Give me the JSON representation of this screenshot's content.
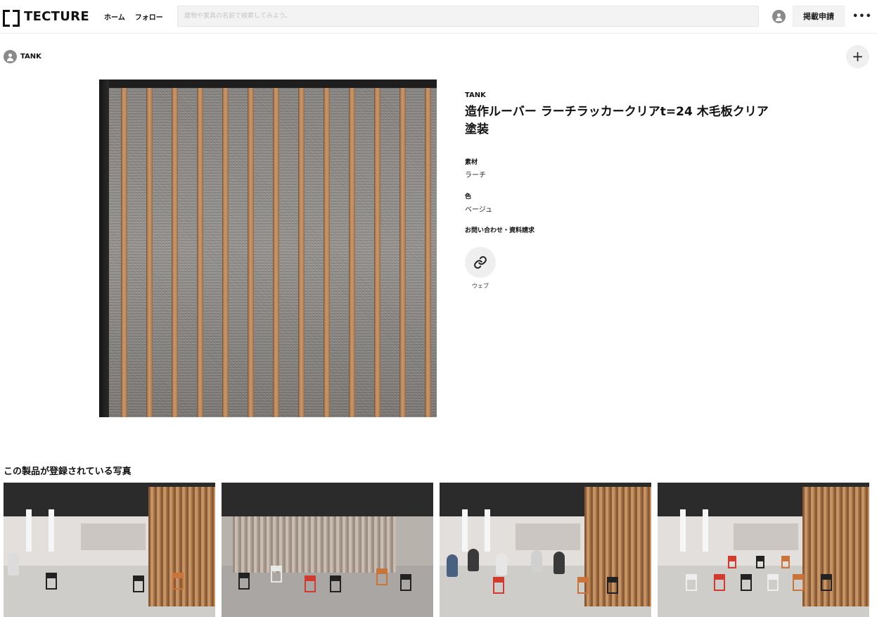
{
  "header": {
    "logo_text": "TECTURE",
    "nav": [
      "ホーム",
      "フォロー"
    ],
    "search_placeholder": "建物や家具の名前で検索してみよう。",
    "apply_label": "掲載申請",
    "more_label": "•••"
  },
  "owner": {
    "name": "TANK"
  },
  "add_label": "+",
  "product": {
    "brand": "TANK",
    "title": "造作ルーバー ラーチラッカークリアt=24 木毛板クリア塗装",
    "material_label": "素材",
    "material_value": "ラーチ",
    "color_label": "色",
    "color_value": "ベージュ",
    "contact_label": "お問い合わせ・資料請求",
    "web_label": "ウェブ"
  },
  "related": {
    "title": "この製品が登録されている写真"
  },
  "icons": {
    "header_avatar": "user-icon",
    "owner_avatar": "user-icon",
    "add": "plus-icon",
    "web": "link-icon",
    "more": "more-horizontal-icon"
  },
  "colors": {
    "accent_gray": "#f3f3f3",
    "avatar_gray": "#8a8a8a",
    "text": "#111111"
  }
}
